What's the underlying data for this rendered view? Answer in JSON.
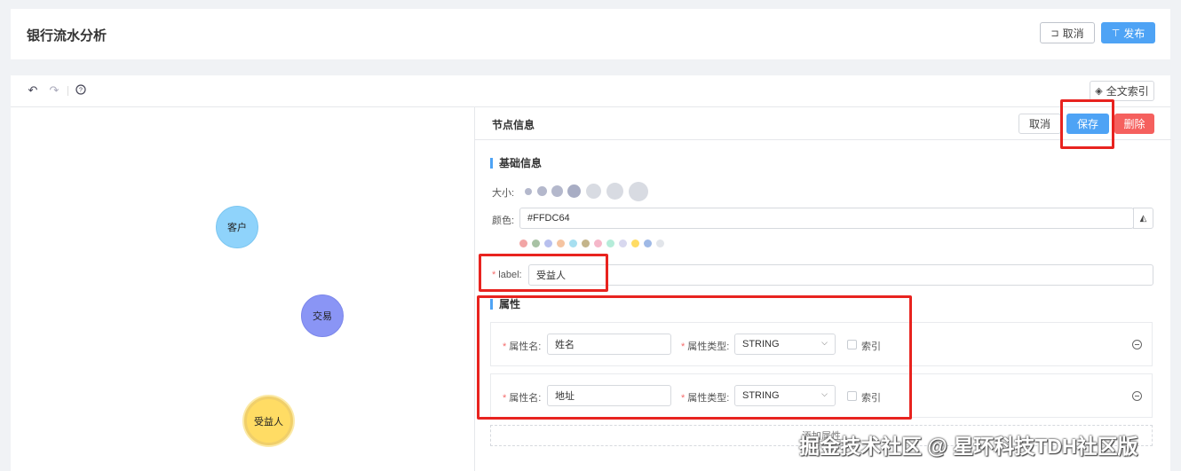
{
  "app": {
    "title": "银行流水分析"
  },
  "header_actions": {
    "cancel_label": "取消",
    "publish_label": "发布"
  },
  "toolbar": {
    "fulltext_index_label": "全文索引"
  },
  "canvas": {
    "nodes": [
      {
        "label": "客户",
        "color": "#8fd3fb"
      },
      {
        "label": "交易",
        "color": "#8a95f5"
      },
      {
        "label": "受益人",
        "color": "#ffdc64"
      }
    ]
  },
  "panel": {
    "title": "节点信息",
    "cancel_label": "取消",
    "save_label": "保存",
    "delete_label": "删除",
    "basic_section": {
      "title": "基础信息",
      "size_label": "大小:",
      "size_options": 7,
      "color_label": "颜色:",
      "color_value": "#FFDC64",
      "palette": [
        "#f2a5a5",
        "#a8c2a4",
        "#b8c0ee",
        "#f5c4a1",
        "#a7dff0",
        "#c4b48a",
        "#f5b7c9",
        "#b5ecd9",
        "#d8d8ef",
        "#ffdc64",
        "#9fb9e6",
        "#e2e5ea"
      ]
    },
    "label_field": {
      "label": "label:",
      "value": "受益人"
    },
    "attributes_section": {
      "title": "属性",
      "name_label": "属性名:",
      "type_label": "属性类型:",
      "index_label": "索引",
      "rows": [
        {
          "name": "姓名",
          "type": "STRING"
        },
        {
          "name": "地址",
          "type": "STRING"
        }
      ],
      "add_label": "添加属性"
    }
  },
  "watermark": "掘金技术社区 @ 星环科技TDH社区版",
  "colors": {
    "primary": "#4ea3f5",
    "danger": "#f5605e",
    "highlight": "#e8231f"
  }
}
